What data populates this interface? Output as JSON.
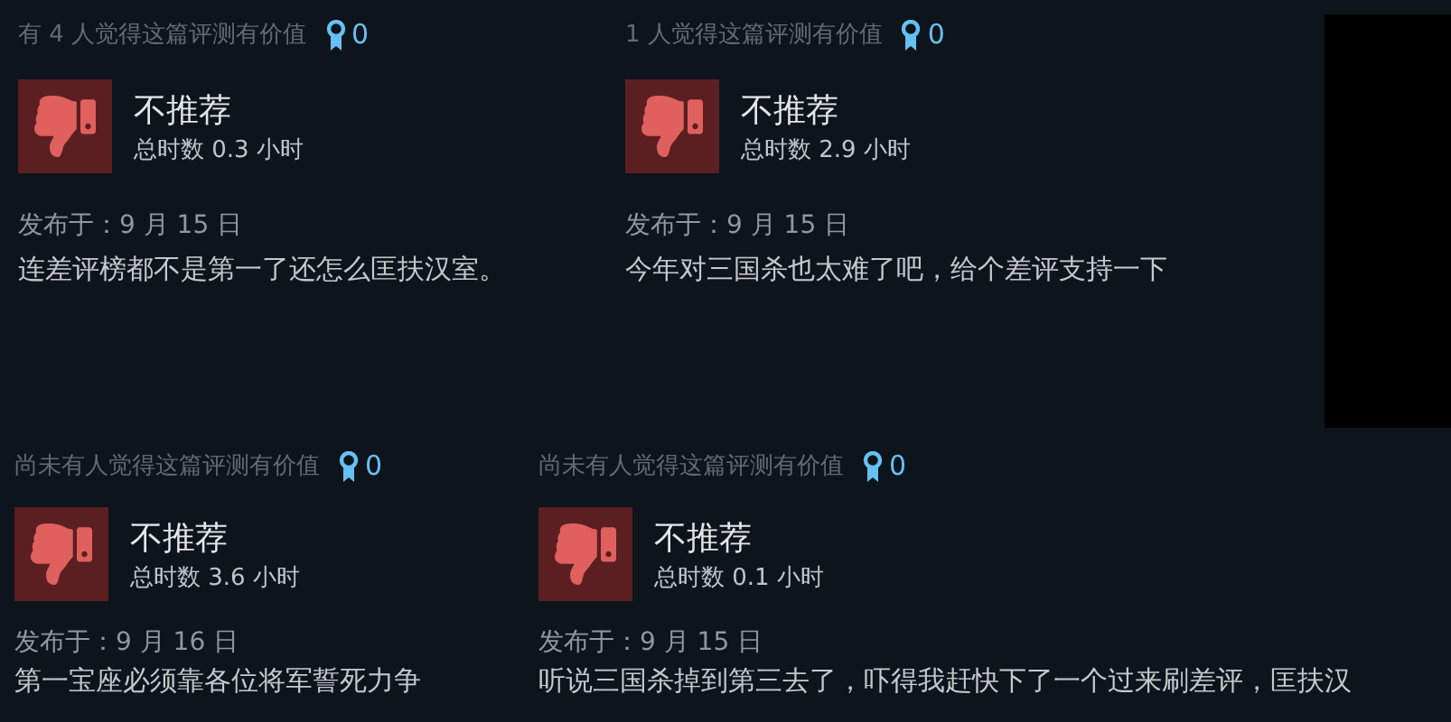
{
  "rows": [
    {
      "reviews": [
        {
          "helpful": "有 4 人觉得这篇评测有价值",
          "awards": "0",
          "verdict": "不推荐",
          "hours": "总时数 0.3 小时",
          "posted": "发布于：9 月 15 日",
          "text": "连差评榜都不是第一了还怎么匡扶汉室。"
        },
        {
          "helpful": "1 人觉得这篇评测有价值",
          "awards": "0",
          "verdict": "不推荐",
          "hours": "总时数 2.9 小时",
          "posted": "发布于：9 月 15 日",
          "text": "今年对三国杀也太难了吧，给个差评支持一下"
        }
      ]
    },
    {
      "reviews": [
        {
          "helpful": "尚未有人觉得这篇评测有价值",
          "awards": "0",
          "verdict": "不推荐",
          "hours": "总时数 3.6 小时",
          "posted": "发布于：9 月 16 日",
          "text": "第一宝座必须靠各位将军誓死力争"
        },
        {
          "helpful": "尚未有人觉得这篇评测有价值",
          "awards": "0",
          "verdict": "不推荐",
          "hours": "总时数 0.1 小时",
          "posted": "发布于：9 月 15 日",
          "text": "听说三国杀掉到第三去了，吓得我赶快下了一个过来刷差评，匡扶汉"
        }
      ]
    }
  ]
}
